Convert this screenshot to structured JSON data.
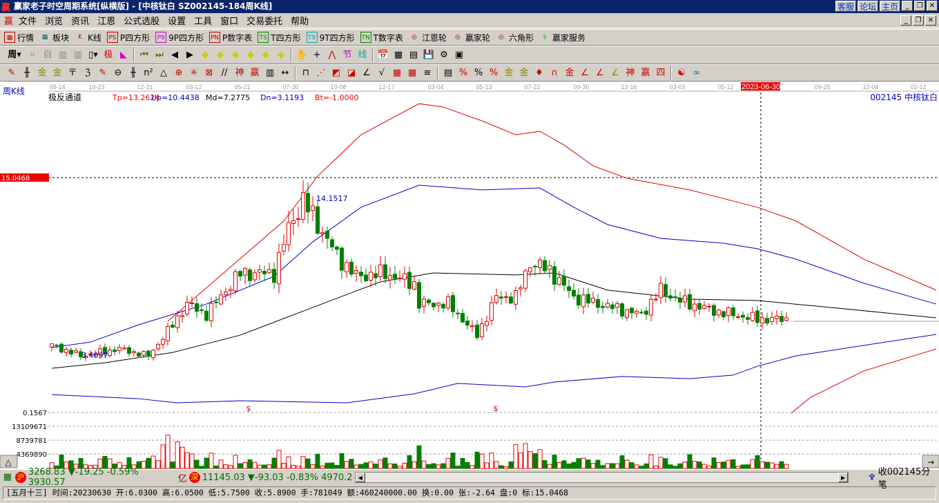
{
  "window": {
    "title": "赢家老子时空周期系统[纵横版] - [中核钛白   SZ002145-184周K线]",
    "links": [
      "客服",
      "论坛",
      "主页"
    ]
  },
  "menu": [
    "文件",
    "浏览",
    "资讯",
    "江恩",
    "公式选股",
    "设置",
    "工具",
    "窗口",
    "交易委托",
    "帮助"
  ],
  "toolbar1": [
    {
      "icon": "PS",
      "label": "行情",
      "name": "quotes"
    },
    {
      "icon": "▦",
      "label": "板块",
      "name": "sector"
    },
    {
      "icon": "K",
      "label": "K线",
      "name": "kline"
    },
    {
      "icon": "PS",
      "label": "P四方形",
      "name": "p-square"
    },
    {
      "icon": "P9",
      "label": "9P四方形",
      "name": "9p-square"
    },
    {
      "icon": "PN",
      "label": "P数字表",
      "name": "p-number-table"
    },
    {
      "icon": "TS",
      "label": "T四方形",
      "name": "t-square"
    },
    {
      "icon": "T9",
      "label": "9T四方形",
      "name": "9t-square"
    },
    {
      "icon": "TN",
      "label": "T数字表",
      "name": "t-number-table"
    },
    {
      "icon": "◎",
      "label": "江恩轮",
      "name": "gann-wheel"
    },
    {
      "icon": "◎",
      "label": "赢家轮",
      "name": "winner-wheel"
    },
    {
      "icon": "◎",
      "label": "六角形",
      "name": "hexagon"
    },
    {
      "icon": "$",
      "label": "赢家服务",
      "name": "winner-service"
    }
  ],
  "period": "周",
  "chart": {
    "period_label": "周K线",
    "indicator_name": "极反通道",
    "indicator_values": {
      "tp": "Tp=13.2624",
      "up": "Up=10.4438",
      "md": "Md=7.2775",
      "dn": "Dn=3.1193",
      "bt": "Bt=-1.0000"
    },
    "stock": "002145  中核钛白",
    "date_ticks": [
      "08-14",
      "10-23",
      "12-31",
      "03-12",
      "05-21",
      "07-30",
      "10-08",
      "12-17",
      "03-04",
      "05-13",
      "07-22",
      "09-30",
      "12-16",
      "03-03",
      "05-12",
      "2023-06-30",
      "09-25",
      "12-04",
      "02-12"
    ],
    "cursor_date": "2023-06-30",
    "cursor_price": "15.0468",
    "high_label": "14.1517",
    "low_label": "3.4097",
    "volume_ticks": [
      "0.1567",
      "13109671",
      "8739781",
      "4369890"
    ],
    "marker": "$",
    "colors": {
      "up": "#e00000",
      "down": "#008000",
      "upper": "#e00000",
      "upper2": "#0000cc",
      "mid": "#000000"
    },
    "close_anchors": [
      [
        0,
        4.09
      ],
      [
        6,
        3.41
      ],
      [
        14,
        3.86
      ],
      [
        20,
        3.41
      ],
      [
        24,
        5.0
      ],
      [
        28,
        6.8
      ],
      [
        32,
        6.1
      ],
      [
        36,
        7.7
      ],
      [
        39,
        8.8
      ],
      [
        46,
        8.8
      ],
      [
        49,
        11.75
      ],
      [
        52,
        13.56
      ],
      [
        56,
        11.5
      ],
      [
        59,
        9.95
      ],
      [
        63,
        8.6
      ],
      [
        69,
        8.8
      ],
      [
        75,
        8.1
      ],
      [
        76,
        6.8
      ],
      [
        82,
        6.8
      ],
      [
        88,
        4.76
      ],
      [
        92,
        7.24
      ],
      [
        96,
        7.24
      ],
      [
        99,
        9.5
      ],
      [
        103,
        9.0
      ],
      [
        108,
        7.24
      ],
      [
        113,
        6.8
      ],
      [
        122,
        6.1
      ],
      [
        126,
        7.7
      ],
      [
        130,
        7.0
      ],
      [
        137,
        6.34
      ],
      [
        146,
        5.8
      ],
      [
        152,
        5.8
      ]
    ],
    "bands": {
      "tp": [
        [
          24,
          5.67
        ],
        [
          48,
          12.21
        ],
        [
          55,
          15.14
        ],
        [
          64,
          17.84
        ],
        [
          76,
          19.87
        ],
        [
          81,
          19.65
        ],
        [
          89,
          18.75
        ],
        [
          96,
          17.84
        ],
        [
          101,
          18.07
        ],
        [
          106,
          17.17
        ],
        [
          112,
          15.81
        ],
        [
          119,
          15.0
        ],
        [
          132,
          14.24
        ],
        [
          146,
          13.11
        ],
        [
          154,
          12.21
        ],
        [
          168,
          9.72
        ],
        [
          183,
          7.7
        ]
      ],
      "up": [
        [
          0,
          3.95
        ],
        [
          8,
          4.31
        ],
        [
          18,
          5.44
        ],
        [
          32,
          6.79
        ],
        [
          46,
          8.6
        ],
        [
          54,
          10.85
        ],
        [
          64,
          13.11
        ],
        [
          76,
          14.55
        ],
        [
          89,
          14.24
        ],
        [
          101,
          14.37
        ],
        [
          108,
          13.11
        ],
        [
          115,
          11.98
        ],
        [
          126,
          11.08
        ],
        [
          139,
          10.76
        ],
        [
          146,
          10.4
        ],
        [
          154,
          9.72
        ],
        [
          168,
          8.15
        ],
        [
          183,
          6.79
        ]
      ],
      "md": [
        [
          0,
          2.6
        ],
        [
          11,
          2.96
        ],
        [
          25,
          3.63
        ],
        [
          39,
          4.76
        ],
        [
          54,
          6.57
        ],
        [
          68,
          8.24
        ],
        [
          79,
          8.82
        ],
        [
          96,
          8.69
        ],
        [
          104,
          8.82
        ],
        [
          115,
          7.7
        ],
        [
          132,
          7.11
        ],
        [
          146,
          7.02
        ],
        [
          161,
          6.57
        ],
        [
          183,
          5.89
        ]
      ],
      "dn": [
        [
          0,
          0.88
        ],
        [
          18,
          0.61
        ],
        [
          26,
          0.34
        ],
        [
          39,
          0.48
        ],
        [
          61,
          0.34
        ],
        [
          75,
          0.93
        ],
        [
          84,
          1.61
        ],
        [
          98,
          1.38
        ],
        [
          104,
          1.7
        ],
        [
          118,
          2.06
        ],
        [
          132,
          1.92
        ],
        [
          141,
          2.15
        ],
        [
          146,
          2.73
        ],
        [
          154,
          3.41
        ],
        [
          168,
          4.09
        ],
        [
          183,
          4.81
        ]
      ],
      "bt": [
        [
          153,
          -0.33
        ],
        [
          157,
          0.7
        ],
        [
          168,
          2.42
        ],
        [
          183,
          3.86
        ]
      ]
    }
  },
  "index_bar": {
    "sh_badge": "沪",
    "sh": "3268.83 ▼-19.25 -0.59% 3930.57",
    "yi": "亿",
    "sz_badge": "深",
    "sz": "11145.03 ▼-93.03 -0.83% 4970.2",
    "feed": "收002145分笔"
  },
  "info_bar": "[五月十三] 时间:20230630 开:6.0300 高:6.0500 低:5.7500 收:5.8900 手:781049 额:460240000.00 换:0.00 张:-2.64 盘:0 标:15.0468"
}
